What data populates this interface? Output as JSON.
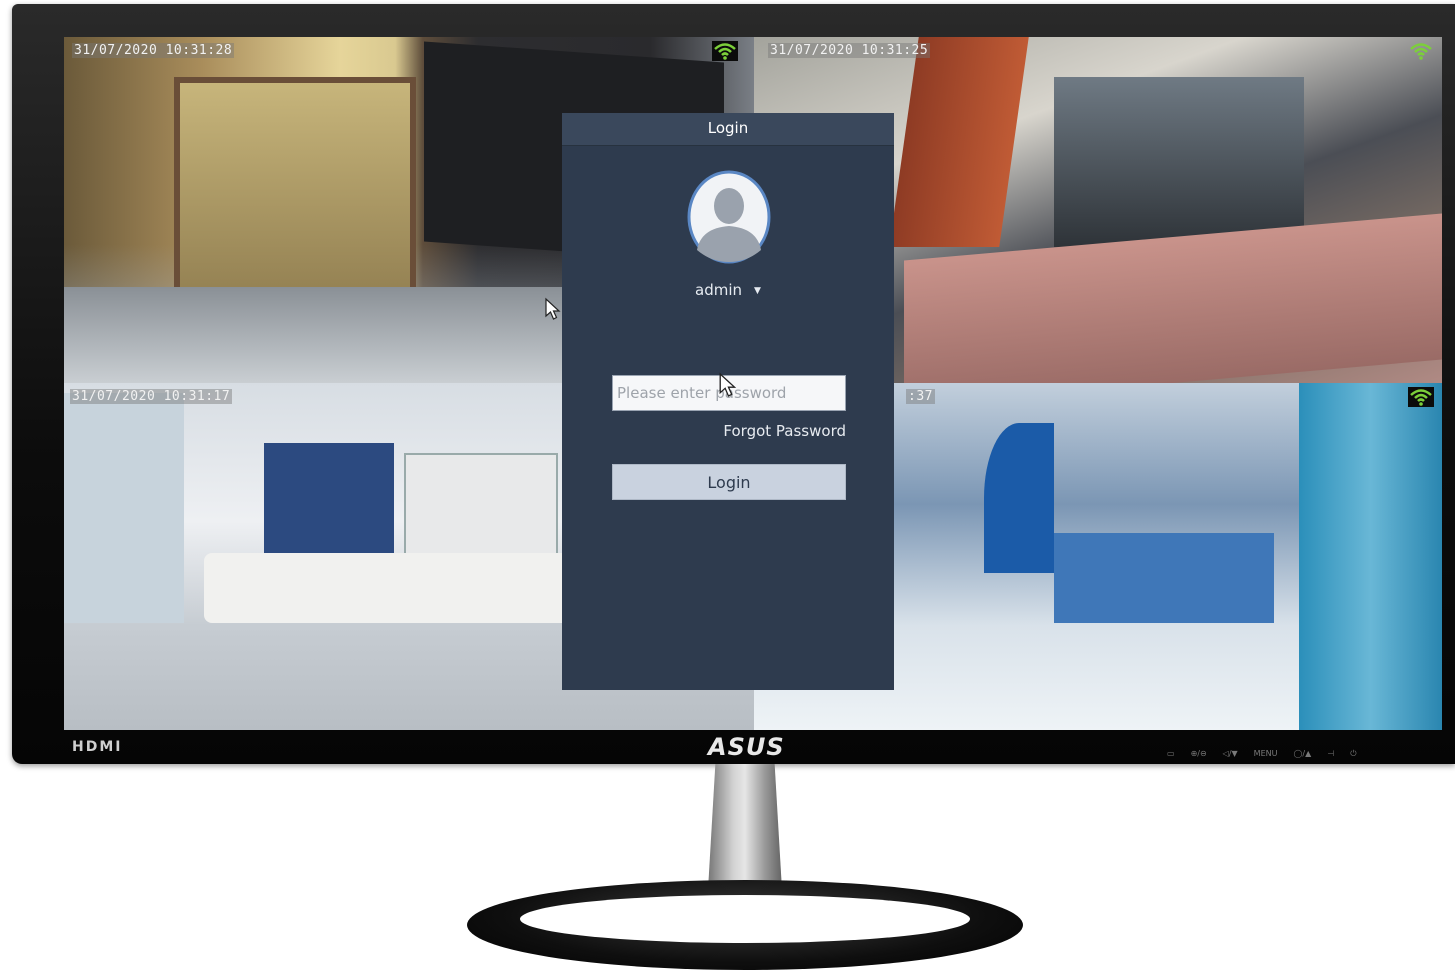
{
  "cameras": [
    {
      "timestamp": "31/07/2020 10:31:28"
    },
    {
      "timestamp": "31/07/2020 10:31:25"
    },
    {
      "timestamp": "31/07/2020 10:31:17"
    },
    {
      "timestamp": ":37"
    }
  ],
  "login": {
    "title": "Login",
    "username": "admin",
    "password_placeholder": "Please enter password",
    "forgot_label": "Forgot Password",
    "button_label": "Login"
  },
  "monitor": {
    "hdmi_label": "HDMI",
    "brand": "ASUS",
    "controls": [
      "▭",
      "⊕/⊖",
      "◁/▼",
      "MENU",
      "◯/▲",
      "⊣",
      "⏻"
    ]
  },
  "icons": {
    "wifi": "wifi-signal-icon",
    "avatar": "user-avatar-icon",
    "caret": "chevron-down-icon",
    "cursor": "mouse-pointer-icon"
  },
  "colors": {
    "panel_bg": "#2e3b4e",
    "button_bg": "#c9d2df",
    "wifi_green": "#7ccf3a"
  }
}
